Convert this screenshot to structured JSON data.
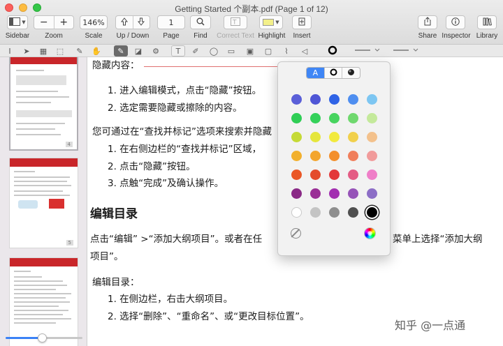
{
  "window": {
    "title": "Getting Started 个副本.pdf (Page 1 of 12)"
  },
  "toolbar": {
    "sidebar_label": "Sidebar",
    "zoom_label": "Zoom",
    "zoom_minus": "−",
    "zoom_plus": "+",
    "scale_label": "Scale",
    "scale_value": "146%",
    "updown_label": "Up / Down",
    "page_label": "Page",
    "page_value": "1",
    "find_label": "Find",
    "correct_text_label": "Correct Text",
    "highlight_label": "Highlight",
    "insert_label": "Insert",
    "share_label": "Share",
    "inspector_label": "Inspector",
    "library_label": "Library",
    "highlight_color": "#f3f08a"
  },
  "sidebar": {
    "thumbnails": [
      {
        "page": "4"
      },
      {
        "page": "5"
      },
      {
        "page": ""
      }
    ]
  },
  "document": {
    "line1": "隐藏内容：",
    "l1_item1": "1.   进入编辑模式，点击“隐藏”按钮。",
    "l1_item2": "2.   选定需要隐藏或擦除的内容。",
    "para1": "您可通过在“查找并标记”选项来搜索并隐藏",
    "l2_item1": "1.   在右侧边栏的“查找并标记”区域，",
    "l2_item2": "2.   点击“隐藏”按钮。",
    "l2_item3": "3.   点触“完成”及确认操作。",
    "heading": "编辑目录",
    "para2a_left": "点击“编辑” >“添加大纲项目”。或者在任",
    "para2a_right": "菜单上选择“添加大纲",
    "para2b": "项目”。",
    "para3": "编辑目录：",
    "l3_item1": "1.   在侧边栏，右击大纲项目。",
    "l3_item2": "2.   选择“删除”、“重命名”、或“更改目标位置”。"
  },
  "popover": {
    "tab_text": "A",
    "swatch_colors": [
      [
        "#5a5fd8",
        "#4f56d6",
        "#2f63e6",
        "#4e8ef0",
        "#7dc6f2"
      ],
      [
        "#2fce55",
        "#34d15a",
        "#47d45f",
        "#6fd86e",
        "#c4e99b"
      ],
      [
        "#c5da36",
        "#e5e63c",
        "#f2ea3d",
        "#f1d04c",
        "#f3c18c"
      ],
      [
        "#f2b02d",
        "#f3a52d",
        "#f38f2b",
        "#f07e5b",
        "#f19b9b"
      ],
      [
        "#ea5726",
        "#e44b2c",
        "#e3383a",
        "#e45c84",
        "#ef7ec8"
      ],
      [
        "#8a2a86",
        "#9a2f96",
        "#a22fb0",
        "#9653b8",
        "#8c6ec6"
      ],
      [
        "#ffffff",
        "#c4c4c4",
        "#8e8e8e",
        "#505050",
        "#000000"
      ]
    ]
  },
  "watermark": "知乎 @一点通"
}
